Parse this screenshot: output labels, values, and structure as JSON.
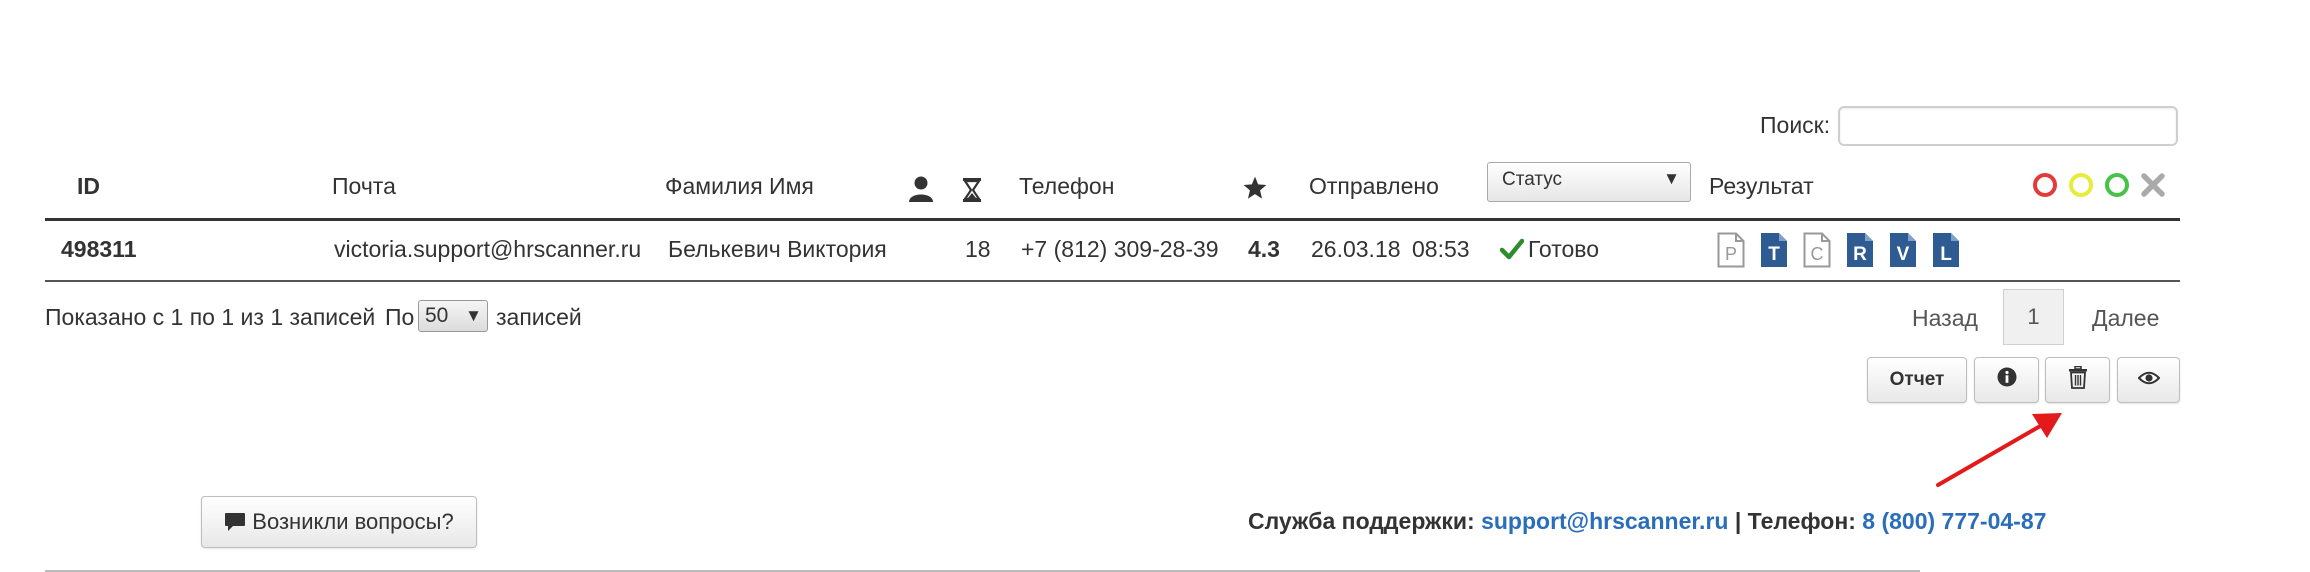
{
  "search": {
    "label": "Поиск:",
    "value": ""
  },
  "columns": {
    "id": "ID",
    "email": "Почта",
    "name": "Фамилия Имя",
    "user_icon": "user-icon",
    "time_icon": "hourglass-icon",
    "phone": "Телефон",
    "rating_icon": "star-icon",
    "sent": "Отправлено",
    "status_select": "Статус",
    "result": "Результат"
  },
  "filter_icons": [
    {
      "name": "red-circle-filter-icon",
      "color": "#e23b3b"
    },
    {
      "name": "yellow-circle-filter-icon",
      "color": "#e6ec3a"
    },
    {
      "name": "green-circle-filter-icon",
      "color": "#48c248"
    },
    {
      "name": "clear-filter-icon",
      "color": "#aaaaaa"
    }
  ],
  "rows": [
    {
      "id": "498311",
      "email": "victoria.support@hrscanner.ru",
      "name": "Белькевич Виктория",
      "time": "18",
      "phone": "+7 (812) 309-28-39",
      "rating": "4.3",
      "date": "26.03.18",
      "time_sent": "08:53",
      "status": "Готово",
      "results": [
        {
          "letter": "P",
          "filled": false
        },
        {
          "letter": "T",
          "filled": true
        },
        {
          "letter": "C",
          "filled": false
        },
        {
          "letter": "R",
          "filled": true
        },
        {
          "letter": "V",
          "filled": true
        },
        {
          "letter": "L",
          "filled": true
        }
      ]
    }
  ],
  "info": {
    "shown": "Показано с 1 по 1 из 1 записей",
    "per_label": "По",
    "per_value": "50",
    "per_suffix": "записей"
  },
  "pagination": {
    "prev": "Назад",
    "current": "1",
    "next": "Далее"
  },
  "actions": {
    "report": "Отчет",
    "info_icon": "info-icon",
    "delete_icon": "trash-icon",
    "view_icon": "eye-icon"
  },
  "help_button": {
    "label": "Возникли вопросы?",
    "icon": "comment-icon"
  },
  "support": {
    "label": "Служба поддержки:",
    "email": "support@hrscanner.ru",
    "separator": "| Телефон:",
    "phone": "8 (800) 777-04-87"
  },
  "colors": {
    "accent_blue": "#2a6ebb",
    "doc_blue": "#2f5b93",
    "status_green": "#2e8b2e",
    "annotation_red": "#e3191c"
  }
}
